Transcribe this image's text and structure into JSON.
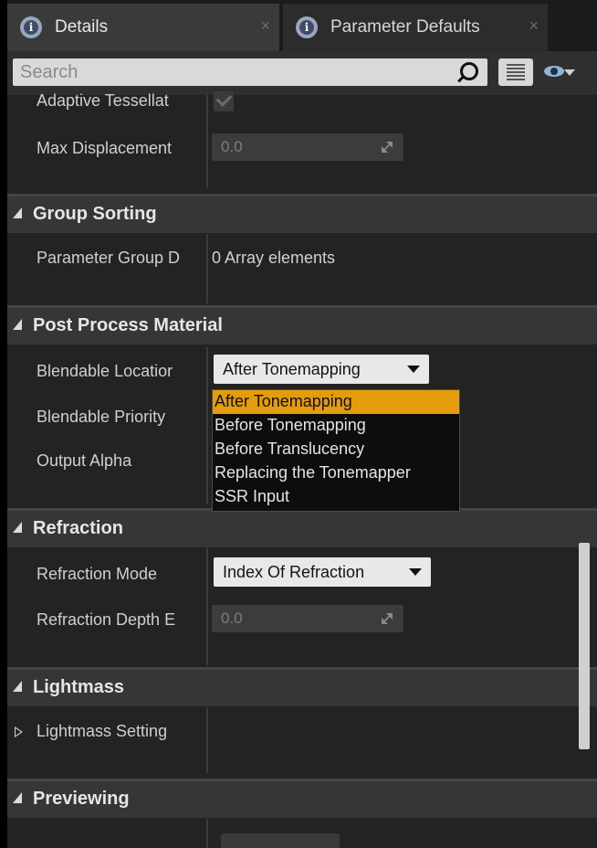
{
  "tabs": [
    {
      "label": "Details",
      "active": true
    },
    {
      "label": "Parameter Defaults",
      "active": false
    }
  ],
  "search": {
    "placeholder": "Search"
  },
  "properties": {
    "adaptive_tessellation_label": "Adaptive Tessellat",
    "max_displacement_label": "Max Displacement",
    "max_displacement_value": "0.0"
  },
  "sections": {
    "group_sorting": {
      "title": "Group Sorting",
      "param_group_label": "Parameter Group D",
      "param_group_value": "0 Array elements"
    },
    "post_process": {
      "title": "Post Process Material",
      "blendable_location_label": "Blendable Locatior",
      "blendable_location_value": "After Tonemapping",
      "blendable_priority_label": "Blendable Priority",
      "output_alpha_label": "Output Alpha",
      "dropdown_options": [
        "After Tonemapping",
        "Before Tonemapping",
        "Before Translucency",
        "Replacing the Tonemapper",
        "SSR Input"
      ],
      "selected_option": "After Tonemapping"
    },
    "refraction": {
      "title": "Refraction",
      "mode_label": "Refraction Mode",
      "mode_value": "Index Of Refraction",
      "depth_bias_label": "Refraction Depth E",
      "depth_bias_value": "0.0"
    },
    "lightmass": {
      "title": "Lightmass",
      "settings_label": "Lightmass Setting"
    },
    "previewing": {
      "title": "Previewing"
    }
  },
  "colors": {
    "selection": "#e59c0a",
    "panel_bg": "#232323",
    "section_bg": "#363636"
  }
}
